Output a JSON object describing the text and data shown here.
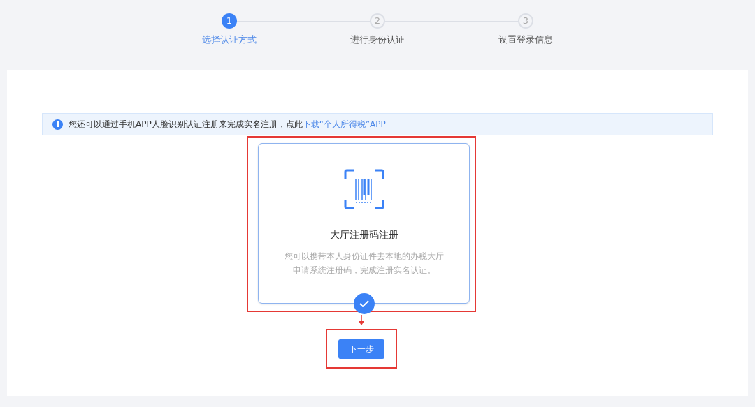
{
  "steps": [
    {
      "number": "1",
      "label": "选择认证方式",
      "selected": true
    },
    {
      "number": "2",
      "label": "进行身份认证",
      "selected": false
    },
    {
      "number": "3",
      "label": "设置登录信息",
      "selected": false
    }
  ],
  "notice": {
    "text": "您还可以通过手机APP人脸识别认证注册来完成实名注册，点此",
    "link": "下载“个人所得税”APP"
  },
  "option": {
    "title": "大厅注册码注册",
    "description": "您可以携带本人身份证件去本地的办税大厅申请系统注册码，完成注册实名认证。",
    "selected": true
  },
  "next_button": "下一步"
}
